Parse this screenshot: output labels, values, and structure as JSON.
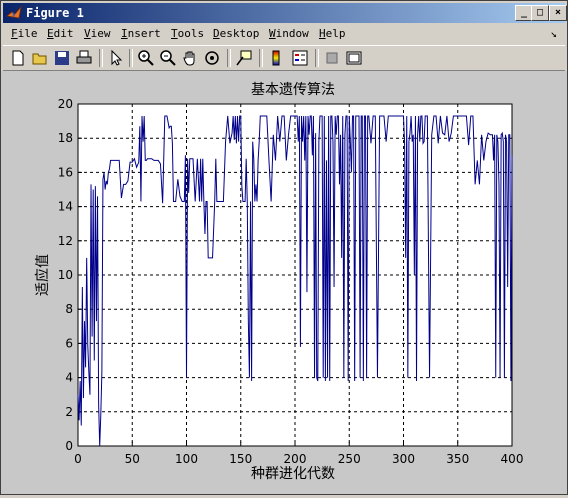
{
  "window": {
    "title": "Figure 1"
  },
  "menu": {
    "items": [
      {
        "first": "F",
        "rest": "ile"
      },
      {
        "first": "E",
        "rest": "dit"
      },
      {
        "first": "V",
        "rest": "iew"
      },
      {
        "first": "I",
        "rest": "nsert"
      },
      {
        "first": "T",
        "rest": "ools"
      },
      {
        "first": "D",
        "rest": "esktop"
      },
      {
        "first": "W",
        "rest": "indow"
      },
      {
        "first": "H",
        "rest": "elp"
      }
    ],
    "arrow": "↘"
  },
  "toolbar": {
    "icons": [
      "new-file-icon",
      "open-file-icon",
      "save-icon",
      "print-icon",
      "pointer-icon",
      "zoom-in-icon",
      "zoom-out-icon",
      "pan-hand-icon",
      "rotate-3d-icon",
      "data-cursor-icon",
      "colorbar-icon",
      "legend-icon",
      "hide-plot-tools-icon",
      "show-plot-tools-icon"
    ]
  },
  "chart_data": {
    "type": "line",
    "title": "基本遗传算法",
    "xlabel": "种群进化代数",
    "ylabel": "适应值",
    "xlim": [
      0,
      400
    ],
    "ylim": [
      0,
      20
    ],
    "xticks": [
      0,
      50,
      100,
      150,
      200,
      250,
      300,
      350,
      400
    ],
    "yticks": [
      0,
      2,
      4,
      6,
      8,
      10,
      12,
      14,
      16,
      18,
      20
    ],
    "grid": true,
    "series_color": "#00008b",
    "x": [
      0,
      1,
      2,
      3,
      4,
      5,
      6,
      7,
      8,
      9,
      10,
      11,
      12,
      13,
      14,
      15,
      16,
      17,
      18,
      19,
      20,
      21,
      22,
      23,
      24,
      25,
      26,
      27,
      28,
      29,
      30,
      32,
      34,
      36,
      38,
      40,
      42,
      44,
      46,
      48,
      50,
      52,
      54,
      56,
      57,
      58,
      59,
      60,
      61,
      62,
      63,
      64,
      66,
      68,
      70,
      72,
      74,
      76,
      78,
      80,
      82,
      84,
      85,
      86,
      87,
      88,
      90,
      92,
      94,
      96,
      98,
      99,
      100,
      101,
      102,
      103,
      104,
      106,
      108,
      110,
      112,
      113,
      114,
      115,
      116,
      117,
      118,
      119,
      120,
      122,
      124,
      126,
      127,
      128,
      130,
      132,
      134,
      136,
      138,
      140,
      142,
      143,
      144,
      145,
      146,
      147,
      148,
      149,
      150,
      151,
      152,
      153,
      154,
      155,
      156,
      157,
      158,
      159,
      160,
      161,
      162,
      163,
      164,
      165,
      166,
      167,
      168,
      170,
      172,
      174,
      176,
      178,
      180,
      182,
      184,
      186,
      188,
      190,
      192,
      194,
      196,
      198,
      200,
      201,
      202,
      203,
      204,
      205,
      206,
      207,
      208,
      209,
      210,
      211,
      212,
      213,
      214,
      215,
      216,
      217,
      218,
      219,
      220,
      221,
      222,
      223,
      224,
      225,
      226,
      227,
      228,
      229,
      230,
      231,
      232,
      233,
      234,
      235,
      236,
      237,
      238,
      239,
      240,
      241,
      242,
      243,
      244,
      245,
      246,
      247,
      248,
      249,
      250,
      251,
      252,
      253,
      254,
      255,
      256,
      257,
      258,
      259,
      260,
      261,
      262,
      263,
      264,
      265,
      266,
      267,
      268,
      270,
      272,
      274,
      276,
      278,
      280,
      282,
      284,
      286,
      288,
      290,
      292,
      294,
      295,
      296,
      297,
      298,
      299,
      300,
      301,
      302,
      303,
      304,
      305,
      306,
      307,
      308,
      309,
      310,
      311,
      312,
      313,
      314,
      315,
      316,
      317,
      318,
      319,
      320,
      322,
      324,
      326,
      328,
      330,
      332,
      334,
      336,
      338,
      340,
      342,
      344,
      346,
      348,
      350,
      351,
      352,
      353,
      354,
      355,
      356,
      357,
      358,
      360,
      362,
      364,
      366,
      368,
      370,
      372,
      374,
      376,
      378,
      380,
      381,
      382,
      383,
      384,
      385,
      386,
      387,
      388,
      389,
      390,
      391,
      392,
      393,
      394,
      395,
      396,
      397,
      398,
      399,
      400
    ],
    "y": [
      3,
      1.5,
      3.8,
      1.2,
      9.3,
      2.8,
      7.3,
      4.6,
      11,
      5.9,
      4.3,
      3,
      15.3,
      6.4,
      15,
      5,
      15.2,
      7.3,
      14.6,
      2.5,
      0,
      1.8,
      4.3,
      15.6,
      16,
      15,
      15.5,
      15.3,
      16,
      16.2,
      16.7,
      16.7,
      16.7,
      16.7,
      16.7,
      14.5,
      15.3,
      15.3,
      15.5,
      16.6,
      16.6,
      16.8,
      16.3,
      16.6,
      18.7,
      14.3,
      19.3,
      17.8,
      19.3,
      16.7,
      16.7,
      16.8,
      16.8,
      16.8,
      16.7,
      16.7,
      16.7,
      16.5,
      14.2,
      19.3,
      19.3,
      18.6,
      18.7,
      18.7,
      17.7,
      14.3,
      14.3,
      15.6,
      14.6,
      14.3,
      14.3,
      17,
      4,
      16.8,
      14.8,
      16.8,
      16.8,
      16.8,
      14.3,
      16.8,
      14.3,
      16.8,
      14.3,
      16.8,
      14.3,
      12.4,
      14.3,
      14.3,
      11,
      11,
      11,
      14.3,
      16.8,
      14.3,
      14.3,
      14.3,
      14.3,
      17.8,
      19.3,
      17.7,
      18.3,
      19.3,
      17.9,
      19.3,
      17.7,
      19.3,
      17.8,
      19.3,
      19.3,
      15.2,
      14.3,
      14.3,
      14.3,
      16.8,
      14.3,
      7.3,
      4,
      14.3,
      3.8,
      17.8,
      16.8,
      14.3,
      15.3,
      14.3,
      16.7,
      17.8,
      19.3,
      19.3,
      19.3,
      19.3,
      16.7,
      14.3,
      18.2,
      16.7,
      19.3,
      17.8,
      19.3,
      19.3,
      16.7,
      18.2,
      19.3,
      19.3,
      19.3,
      19.3,
      19.3,
      17.8,
      19.3,
      5.8,
      19.3,
      17.8,
      19.3,
      16.7,
      19.3,
      9,
      19.3,
      18.2,
      19.3,
      19.3,
      17,
      19.3,
      4,
      18.3,
      4,
      3.8,
      17.8,
      19.3,
      19.3,
      19.3,
      4,
      19.3,
      3.8,
      16.7,
      4,
      19.3,
      3.8,
      19.3,
      19.3,
      17.8,
      9.3,
      19.3,
      18.2,
      19.3,
      19.3,
      15.3,
      18.2,
      11,
      19.3,
      4,
      18.2,
      19.3,
      19.3,
      3.8,
      19.3,
      17.8,
      16,
      19.3,
      19.3,
      3.8,
      19.3,
      19.3,
      19.3,
      19.3,
      4,
      19.3,
      19.3,
      3.8,
      19.3,
      19.3,
      4,
      19.3,
      19.3,
      17.7,
      19.3,
      19.3,
      4,
      19.3,
      19.3,
      19.3,
      17.8,
      19.3,
      19.3,
      19.3,
      19.3,
      19.3,
      19.3,
      19.3,
      19.3,
      19.3,
      19.3,
      19.3,
      17.7,
      11,
      19.3,
      4,
      17.8,
      18.3,
      19.3,
      17.8,
      18.2,
      10,
      19.3,
      3.8,
      18.2,
      19.3,
      17.8,
      19.3,
      19.3,
      17.7,
      17.8,
      19.3,
      19.3,
      4,
      18.2,
      19.3,
      19.3,
      17.7,
      19.3,
      18.3,
      18.2,
      19.3,
      17.8,
      18.3,
      19.3,
      19.3,
      19.3,
      19.3,
      19.3,
      19.3,
      19.3,
      19.3,
      19.3,
      19.3,
      19.3,
      17.6,
      19.3,
      19.3,
      15.3,
      16.7,
      15.3,
      18.2,
      16.7,
      17.8,
      18.3,
      18.2,
      18.2,
      18.2,
      16.7,
      18.2,
      4,
      18.2,
      17.8,
      15.3,
      4,
      18.2,
      18.3,
      17.8,
      4,
      18.2,
      17.8,
      9.3,
      18.2,
      18.2,
      3.8,
      17,
      17.8,
      18.3,
      16.7,
      18.2,
      15.3,
      18.2,
      16.7,
      14.5,
      18.2,
      17,
      17,
      17,
      16.7,
      17.2
    ]
  }
}
